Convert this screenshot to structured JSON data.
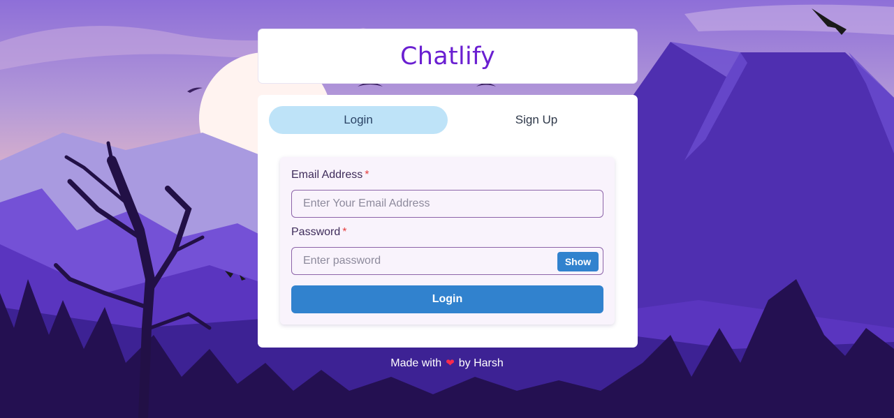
{
  "app": {
    "title": "Chatlify"
  },
  "tabs": [
    {
      "label": "Login",
      "active": true
    },
    {
      "label": "Sign Up",
      "active": false
    }
  ],
  "form": {
    "email_label": "Email Address",
    "email_placeholder": "Enter Your Email Address",
    "email_value": "",
    "password_label": "Password",
    "password_placeholder": "Enter password",
    "password_value": "",
    "required_mark": "*",
    "show_label": "Show",
    "submit_label": "Login"
  },
  "footer": {
    "prefix": "Made with",
    "heart_icon": "heart-icon",
    "suffix": "by Harsh"
  },
  "colors": {
    "brand_title": "#6a1fd1",
    "accent": "#3182ce",
    "active_tab": "#bee3f8",
    "required": "#e53e3e",
    "heart": "#ff2b4a"
  }
}
